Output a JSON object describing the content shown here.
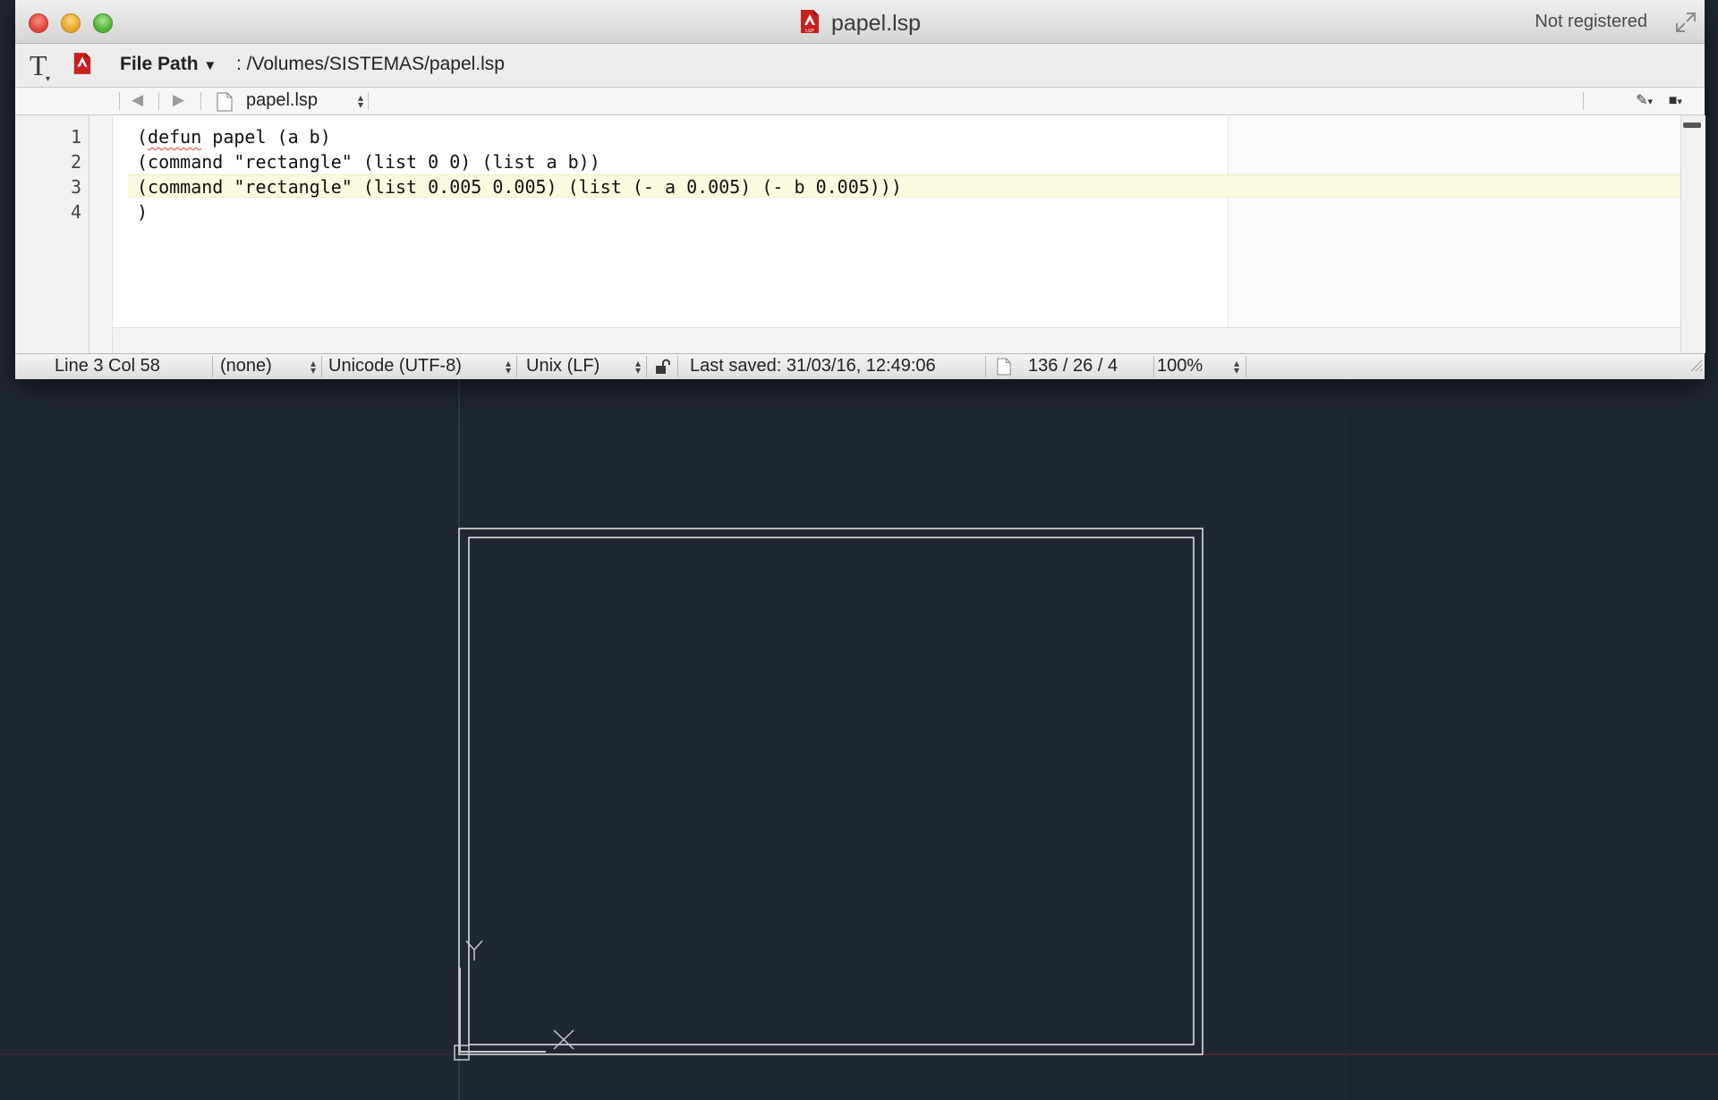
{
  "window": {
    "title": "papel.lsp",
    "registration": "Not registered",
    "file_icon": "lsp-file-icon",
    "file_icon_label": "LSP"
  },
  "pathbar": {
    "path_label": "File Path",
    "path_value": ": /Volumes/SISTEMAS/papel.lsp"
  },
  "navbar": {
    "file_name": "papel.lsp"
  },
  "editor": {
    "lines": [
      {
        "number": "1",
        "text": "(defun papel (a b)"
      },
      {
        "number": "2",
        "text": "(command \"rectangle\" (list 0 0) (list a b))"
      },
      {
        "number": "3",
        "text": "(command \"rectangle\" (list 0.005 0.005) (list (- a 0.005) (- b 0.005)))"
      },
      {
        "number": "4",
        "text": ")"
      }
    ],
    "current_line": 3,
    "misspelled_word": "defun"
  },
  "statusbar": {
    "position": "Line 3 Col 58",
    "syntax": "(none)",
    "encoding": "Unicode (UTF-8)",
    "line_endings": "Unix (LF)",
    "last_saved": "Last saved: 31/03/16, 12:49:06",
    "counts": "136 / 26 / 4",
    "zoom": "100%"
  },
  "canvas": {
    "background": "#212732",
    "ucs_y_label": "Y",
    "ucs_x_label": "X"
  },
  "colors": {
    "current_line": "#fbf9df",
    "misspelling": "#e23a3a",
    "file_icon": "#c8201f"
  }
}
